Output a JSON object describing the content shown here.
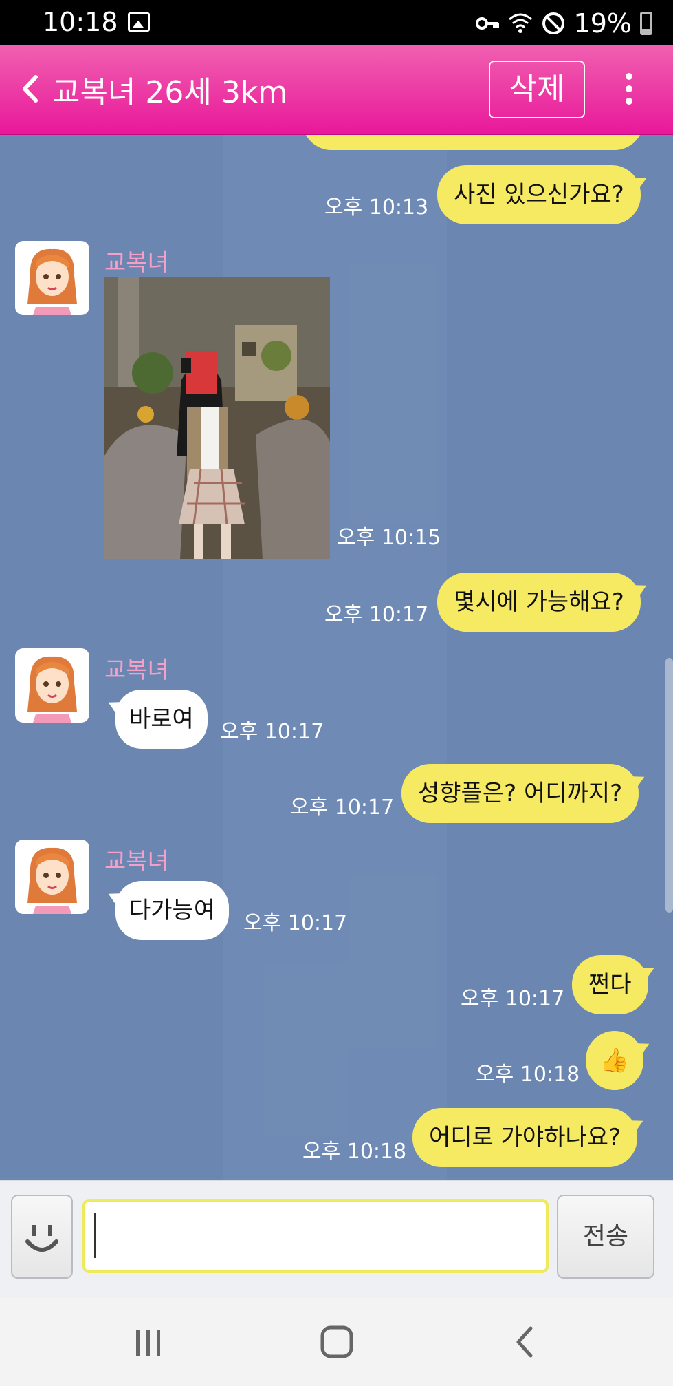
{
  "status_bar": {
    "time": "10:18",
    "battery_percent": "19%"
  },
  "header": {
    "title": "교복녀 26세 3km",
    "delete_label": "삭제"
  },
  "chat": {
    "partial_top_time": "오후 10:13",
    "messages": [
      {
        "from": "me",
        "text": "사진 있으신가요?",
        "time": "오후 10:13"
      },
      {
        "from": "them",
        "sender": "교복녀",
        "type": "photo",
        "time": "오후 10:15"
      },
      {
        "from": "me",
        "text": "몇시에 가능해요?",
        "time": "오후 10:17"
      },
      {
        "from": "them",
        "sender": "교복녀",
        "text": "바로여",
        "time": "오후 10:17"
      },
      {
        "from": "me",
        "text": "성향플은? 어디까지?",
        "time": "오후 10:17"
      },
      {
        "from": "them",
        "sender": "교복녀",
        "text": "다가능여",
        "time": "오후 10:17"
      },
      {
        "from": "me",
        "text": "쩐다",
        "time": "오후 10:17"
      },
      {
        "from": "me",
        "text": "👍",
        "emoji_name": "thumbs-up-icon",
        "time": "오후 10:18"
      },
      {
        "from": "me",
        "text": "어디로 가야하나요?",
        "time": "오후 10:18"
      }
    ]
  },
  "input": {
    "value": "",
    "send_label": "전송"
  },
  "colors": {
    "header_pink": "#e9189a",
    "chat_bg": "#6a86b1",
    "my_bubble": "#f6ea63",
    "sender_name": "#f5a0c8"
  }
}
